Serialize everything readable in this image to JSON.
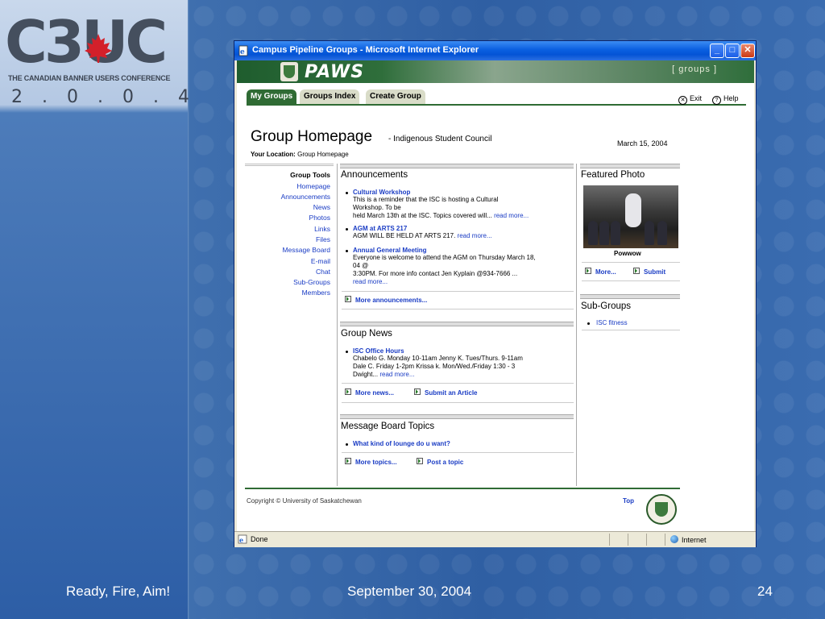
{
  "slide": {
    "logo_text": "C3UC",
    "logo_subtitle": "THE CANADIAN BANNER USERS CONFERENCE",
    "logo_year": "2.0.0.4",
    "footer_left": "Ready, Fire, Aim!",
    "footer_center": "September 30, 2004",
    "footer_page": "24"
  },
  "window": {
    "title": "Campus Pipeline Groups - Microsoft Internet Explorer",
    "minimize": "_",
    "maximize": "□",
    "close": "✕"
  },
  "banner": {
    "logo_text": "PAWS",
    "tag": "[ groups ]"
  },
  "tabs": [
    {
      "label": "My Groups",
      "active": true
    },
    {
      "label": "Groups Index",
      "active": false
    },
    {
      "label": "Create Group",
      "active": false
    }
  ],
  "toplinks": {
    "exit": "Exit",
    "help": "Help"
  },
  "page": {
    "title": "Group Homepage",
    "subtitle": "- Indigenous Student Council",
    "date": "March 15, 2004",
    "location_label": "Your Location:",
    "location_value": "Group Homepage"
  },
  "nav": {
    "heading": "Group Tools",
    "items": [
      "Homepage",
      "Announcements",
      "News",
      "Photos",
      "Links",
      "Files",
      "Message Board",
      "E-mail",
      "Chat",
      "Sub-Groups",
      "Members"
    ]
  },
  "announcements": {
    "heading": "Announcements",
    "items": [
      {
        "title": "Cultural Workshop",
        "lines": [
          "This is a reminder that the ISC is hosting a Cultural",
          "Workshop.  To be",
          "held March 13th at the ISC. Topics covered will..."
        ],
        "more": "read more..."
      },
      {
        "title": "AGM at ARTS 217",
        "lines": [
          "AGM WILL BE HELD AT ARTS 217."
        ],
        "more": "read more..."
      },
      {
        "title": "Annual General Meeting",
        "lines": [
          "Everyone is welcome to attend the AGM on Thursday March 18,",
          "04 @",
          "3:30PM.  For more info contact Jen Kyplain @934-7666 ..."
        ],
        "more": "read more..."
      }
    ],
    "more_link": "More announcements..."
  },
  "news": {
    "heading": "Group News",
    "items": [
      {
        "title": "ISC Office Hours",
        "lines": [
          "Chabelo G. Monday 10-11am Jenny K. Tues/Thurs.  9-11am",
          "Dale C. Friday 1-2pm Krissa k. Mon/Wed./Friday 1:30 - 3",
          "Dwight..."
        ],
        "more": "read more..."
      }
    ],
    "more_link": "More news...",
    "submit_link": "Submit an Article"
  },
  "board": {
    "heading": "Message Board Topics",
    "items": [
      "What kind of lounge do u want?"
    ],
    "more_link": "More topics...",
    "post_link": "Post a topic"
  },
  "featured": {
    "heading": "Featured Photo",
    "caption": "Powwow",
    "more_link": "More...",
    "submit_link": "Submit"
  },
  "subgroups": {
    "heading": "Sub-Groups",
    "items": [
      "ISC fitness"
    ]
  },
  "footer": {
    "copyright": "Copyright © University of Saskatchewan",
    "top_link": "Top"
  },
  "status": {
    "text": "Done",
    "zone": "Internet"
  }
}
